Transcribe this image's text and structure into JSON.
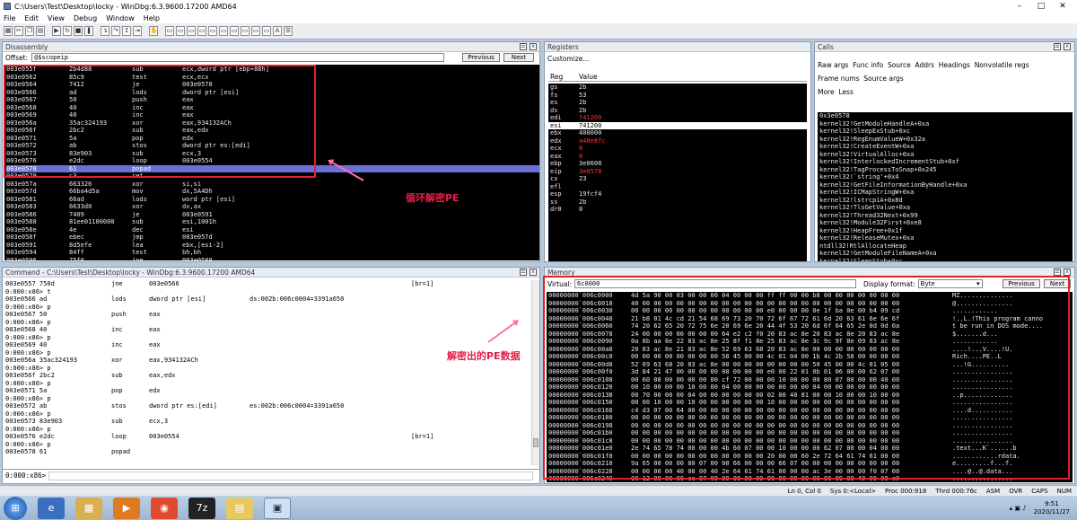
{
  "window": {
    "title": "C:\\Users\\Test\\Desktop\\locky - WinDbg:6.3.9600.17200 AMD64"
  },
  "menu": [
    "File",
    "Edit",
    "View",
    "Debug",
    "Window",
    "Help"
  ],
  "disassembly": {
    "title": "Disassembly",
    "offset_label": "Offset:",
    "offset_value": "@$scopeip",
    "prev": "Previous",
    "next": "Next",
    "lines": [
      [
        "003e055f",
        "2b4d88",
        "sub",
        "ecx,dword ptr [ebp+88h]"
      ],
      [
        "003e0562",
        "85c9",
        "test",
        "ecx,ecx"
      ],
      [
        "003e0564",
        "7412",
        "je",
        "003e0578"
      ],
      [
        "003e0566",
        "ad",
        "lods",
        "dword ptr [esi]"
      ],
      [
        "003e0567",
        "50",
        "push",
        "eax"
      ],
      [
        "003e0568",
        "40",
        "inc",
        "eax"
      ],
      [
        "003e0569",
        "40",
        "inc",
        "eax"
      ],
      [
        "003e056a",
        "35ac324193",
        "xor",
        "eax,934132ACh"
      ],
      [
        "003e056f",
        "2bc2",
        "sub",
        "eax,edx"
      ],
      [
        "003e0571",
        "5a",
        "pop",
        "edx"
      ],
      [
        "003e0572",
        "ab",
        "stos",
        "dword ptr es:[edi]"
      ],
      [
        "003e0573",
        "83e903",
        "sub",
        "ecx,3"
      ],
      [
        "003e0576",
        "e2dc",
        "loop",
        "003e0554"
      ],
      [
        "003e0578",
        "61",
        "popad",
        ""
      ],
      [
        "003e0579",
        "c3",
        "ret",
        ""
      ],
      [
        "003e057a",
        "663326",
        "xor",
        "si,si"
      ],
      [
        "003e057d",
        "66ba4d5a",
        "mov",
        "dx,5A4Dh"
      ],
      [
        "003e0581",
        "66ad",
        "lods",
        "word ptr [esi]"
      ],
      [
        "003e0583",
        "6633d0",
        "xor",
        "dx,ax"
      ],
      [
        "003e0586",
        "7409",
        "je",
        "003e0591"
      ],
      [
        "003e0588",
        "81ee01100000",
        "sub",
        "esi,1001h"
      ],
      [
        "003e058e",
        "4e",
        "dec",
        "esi"
      ],
      [
        "003e058f",
        "ebec",
        "jmp",
        "003e057d"
      ],
      [
        "003e0591",
        "8d5efe",
        "lea",
        "ebx,[esi-2]"
      ],
      [
        "003e0594",
        "84ff",
        "test",
        "bh,bh"
      ],
      [
        "003e0596",
        "75f0",
        "jne",
        "003e0588"
      ]
    ],
    "highlight_index": 13
  },
  "registers": {
    "title": "Registers",
    "customize": "Customize...",
    "col_reg": "Reg",
    "col_value": "Value",
    "rows": [
      [
        "gs",
        "2b",
        false
      ],
      [
        "fs",
        "53",
        false
      ],
      [
        "es",
        "2b",
        false
      ],
      [
        "ds",
        "2b",
        false
      ],
      [
        "edi",
        "741200",
        true
      ],
      [
        "esi",
        "741200",
        false
      ],
      [
        "ebx",
        "400000",
        false
      ],
      [
        "edx",
        "a48e8fc",
        true
      ],
      [
        "ecx",
        "0",
        true
      ],
      [
        "eax",
        "0",
        true
      ],
      [
        "ebp",
        "3e0608",
        false
      ],
      [
        "eip",
        "3e0578",
        true
      ],
      [
        "cs",
        "23",
        false
      ],
      [
        "efl",
        "",
        false
      ],
      [
        "esp",
        "19fcf4",
        false
      ],
      [
        "ss",
        "2b",
        false
      ],
      [
        "dr0",
        "0",
        false
      ]
    ],
    "selected_index": 5
  },
  "calls": {
    "title": "Calls",
    "options": [
      "Raw args",
      "Func info",
      "Source",
      "Addrs",
      "Headings",
      "Nonvolatile regs",
      "Frame nums",
      "Source args",
      "More",
      "Less"
    ],
    "frames": [
      "0x3e0578",
      "kernel32!GetModuleHandleA+0xa",
      "kernel32!SleepExStub+0xc",
      "kernel32!RegEnumValueW+0x32a",
      "kernel32!CreateEventW+0xa",
      "kernel32!VirtualAlloc+0xa",
      "kernel32!InterlockedIncrementStub+0xf",
      "kernel32!TagProcessToSnap+0x245",
      "kernel32!`string'+0x4",
      "kernel32!GetFileInformationByHandle+0xa",
      "kernel32!ICMapStringW+0xa",
      "kernel32!lstrcpiA+0x8d",
      "kernel32!TlsGetValue+0xa",
      "kernel32!Thread32Next+0x99",
      "kernel32!Module32First+0xe8",
      "kernel32!HeapFree+0x1f",
      "kernel32!ReleaseMutex+0xa",
      "ntdll32!RtlAllocateHeap",
      "kernel32!GetModuleFileNameA+0xa",
      "kernel32!SleepStub+0xc"
    ]
  },
  "command": {
    "title": "Command - C:\\Users\\Test\\Desktop\\locky - WinDbg:6.3.9600.17200 AMD64",
    "lines": [
      [
        "003e0557 750d",
        "jne",
        "003e0566",
        "",
        "[br=1]"
      ],
      [
        "0:000:x86> t",
        "",
        "",
        "",
        ""
      ],
      [
        "003e0566 ad",
        "lods",
        "dword ptr [esi]",
        "ds:002b:006c0004=3391a650",
        ""
      ],
      [
        "0:000:x86> p",
        "",
        "",
        "",
        ""
      ],
      [
        "003e0567 50",
        "push",
        "eax",
        "",
        ""
      ],
      [
        "0:000:x86> p",
        "",
        "",
        "",
        ""
      ],
      [
        "003e0568 40",
        "inc",
        "eax",
        "",
        ""
      ],
      [
        "0:000:x86> p",
        "",
        "",
        "",
        ""
      ],
      [
        "003e0569 40",
        "inc",
        "eax",
        "",
        ""
      ],
      [
        "0:000:x86> p",
        "",
        "",
        "",
        ""
      ],
      [
        "003e056a 35ac324193",
        "xor",
        "eax,934132ACh",
        "",
        ""
      ],
      [
        "0:000:x86> p",
        "",
        "",
        "",
        ""
      ],
      [
        "003e056f 2bc2",
        "sub",
        "eax,edx",
        "",
        ""
      ],
      [
        "0:000:x86> p",
        "",
        "",
        "",
        ""
      ],
      [
        "003e0571 5a",
        "pop",
        "edx",
        "",
        ""
      ],
      [
        "0:000:x86> p",
        "",
        "",
        "",
        ""
      ],
      [
        "003e0572 ab",
        "stos",
        "dword ptr es:[edi]",
        "es:002b:006c0004=3391a650",
        ""
      ],
      [
        "0:000:x86> p",
        "",
        "",
        "",
        ""
      ],
      [
        "003e0573 83e903",
        "sub",
        "ecx,3",
        "",
        ""
      ],
      [
        "0:000:x86> p",
        "",
        "",
        "",
        ""
      ],
      [
        "003e0576 e2dc",
        "loop",
        "003e0554",
        "",
        "[br=1]"
      ],
      [
        "0:000:x86> p",
        "",
        "",
        "",
        ""
      ],
      [
        "003e0578 61",
        "popad",
        "",
        "",
        ""
      ]
    ],
    "prompt": "0:000:x86>"
  },
  "memory": {
    "title": "Memory",
    "virtual_label": "Virtual:",
    "virtual_value": "6c0000",
    "format_label": "Display format:",
    "format_value": "Byte",
    "prev": "Previous",
    "next": "Next",
    "rows": [
      [
        "00000000`006c0000",
        "4d 5a 90 00 03 00 00 00 04 00 00 00 ff ff 00 00 b8 00 00 00 00 00 00 00",
        "MZ.............."
      ],
      [
        "00000000`006c0018",
        "40 00 00 00 00 00 00 00 00 00 00 00 00 00 00 00 00 00 00 00 00 00 00 00",
        "@..............."
      ],
      [
        "00000000`006c0030",
        "00 00 00 00 00 00 00 00 00 00 00 00 e0 00 00 00 0e 1f ba 0e 00 b4 09 cd",
        "............"
      ],
      [
        "00000000`006c0048",
        "21 b8 01 4c cd 21 54 68 69 73 20 70 72 6f 67 72 61 6d 20 63 61 6e 6e 6f",
        "!..L.!This program canno"
      ],
      [
        "00000000`006c0060",
        "74 20 62 65 20 72 75 6e 20 69 6e 20 44 4f 53 20 6d 6f 64 65 2e 0d 0d 0a",
        "t be run in DOS mode...."
      ],
      [
        "00000000`006c0078",
        "24 00 00 00 00 00 00 00 64 e2 c2 f0 20 83 ac 8e 20 83 ac 8e 20 83 ac 8e",
        "$.......d..."
      ],
      [
        "00000000`006c0090",
        "0a 8b aa 8e 22 83 ac 8e 25 8f f1 8e 25 83 ac 8e 3c 9c 9f 8e 09 83 ac 8e",
        "............"
      ],
      [
        "00000000`006c00a8",
        "20 83 ac 8e 21 83 ac 8e 52 69 63 68 20 83 ac 8e 00 00 00 00 00 00 00 00",
        "....!...V....!U."
      ],
      [
        "00000000`006c00c0",
        "00 00 00 00 00 00 00 00 50 45 00 00 4c 01 04 00 1b 4c 2b 58 00 00 00 00",
        "Rich....PE..L"
      ],
      [
        "00000000`006c00d8",
        "52 69 63 68 20 83 ac 8e 00 00 00 00 00 00 00 00 50 45 00 00 4c 01 05 00",
        "...!G.........."
      ],
      [
        "00000000`006c00f0",
        "3d 84 21 47 00 00 00 00 00 00 00 00 e0 00 22 01 0b 01 06 00 00 62 07 00",
        "................"
      ],
      [
        "00000000`006c0108",
        "00 60 08 00 00 00 00 00 cf 72 00 00 00 10 00 00 00 80 07 00 00 00 40 00",
        "................"
      ],
      [
        "00000000`006c0120",
        "00 10 00 00 00 10 00 00 04 00 00 00 00 00 00 00 04 00 00 00 00 00 00 00",
        "................"
      ],
      [
        "00000000`006c0138",
        "00 70 00 00 00 04 00 00 00 00 00 00 02 00 40 81 00 00 10 00 00 10 00 00",
        "..p............."
      ],
      [
        "00000000`006c0150",
        "00 00 10 00 00 10 00 00 00 00 00 00 10 00 00 00 00 00 00 00 00 00 00 00",
        "................"
      ],
      [
        "00000000`006c0168",
        "c4 d3 07 00 64 00 00 00 00 00 00 00 00 00 00 00 00 00 00 00 00 00 00 00",
        "....d..........."
      ],
      [
        "00000000`006c0180",
        "00 00 00 00 00 00 00 00 00 00 00 00 00 00 00 00 00 00 00 00 00 00 00 00",
        "................"
      ],
      [
        "00000000`006c0198",
        "00 00 00 00 00 00 00 00 00 00 00 00 00 00 00 00 00 00 00 00 00 00 00 00",
        "................"
      ],
      [
        "00000000`006c01b0",
        "00 00 00 00 00 00 00 00 00 00 00 00 00 00 00 00 00 00 00 00 00 00 00 00",
        "................"
      ],
      [
        "00000000`006c01c8",
        "00 00 00 00 00 00 00 00 00 00 00 00 00 00 00 00 00 00 00 00 00 00 00 00",
        "................"
      ],
      [
        "00000000`006c01e0",
        "2e 74 65 78 74 00 00 00 4b 60 07 00 00 10 00 00 00 62 07 00 00 04 00 00",
        ".text...K`......b"
      ],
      [
        "00000000`006c01f8",
        "00 00 00 00 00 00 00 00 00 00 00 00 20 00 00 60 2e 72 64 61 74 61 00 00",
        "............rdata."
      ],
      [
        "00000000`006c0210",
        "9a 65 00 00 00 80 07 00 00 66 00 00 00 66 07 00 00 00 00 00 00 00 00 00",
        "e.........f...f."
      ],
      [
        "00000000`006c0228",
        "00 00 00 00 40 00 00 40 2e 64 61 74 61 00 00 00 ac 3e 00 00 00 f0 07 00",
        "....@..@.data..."
      ],
      [
        "00000000`006c0240",
        "00 12 00 00 00 cc 07 00 00 00 00 00 00 00 00 00 00 00 00 00 40 00 00 c0",
        "................"
      ]
    ]
  },
  "annotations": {
    "loop": "循环解密PE",
    "pe": "解密出的PE数据"
  },
  "status": [
    "Ln 0, Col 0",
    "Sys 0:<Local>",
    "Proc 000:918",
    "Thrd 000:76c",
    "ASM",
    "OVR",
    "CAPS",
    "NUM"
  ],
  "taskbar": {
    "time": "9:51",
    "date": "2020/11/27",
    "icons": [
      "start-orb",
      "ie",
      "explorer",
      "media",
      "chrome",
      "7zip",
      "folder",
      "windbg"
    ]
  }
}
